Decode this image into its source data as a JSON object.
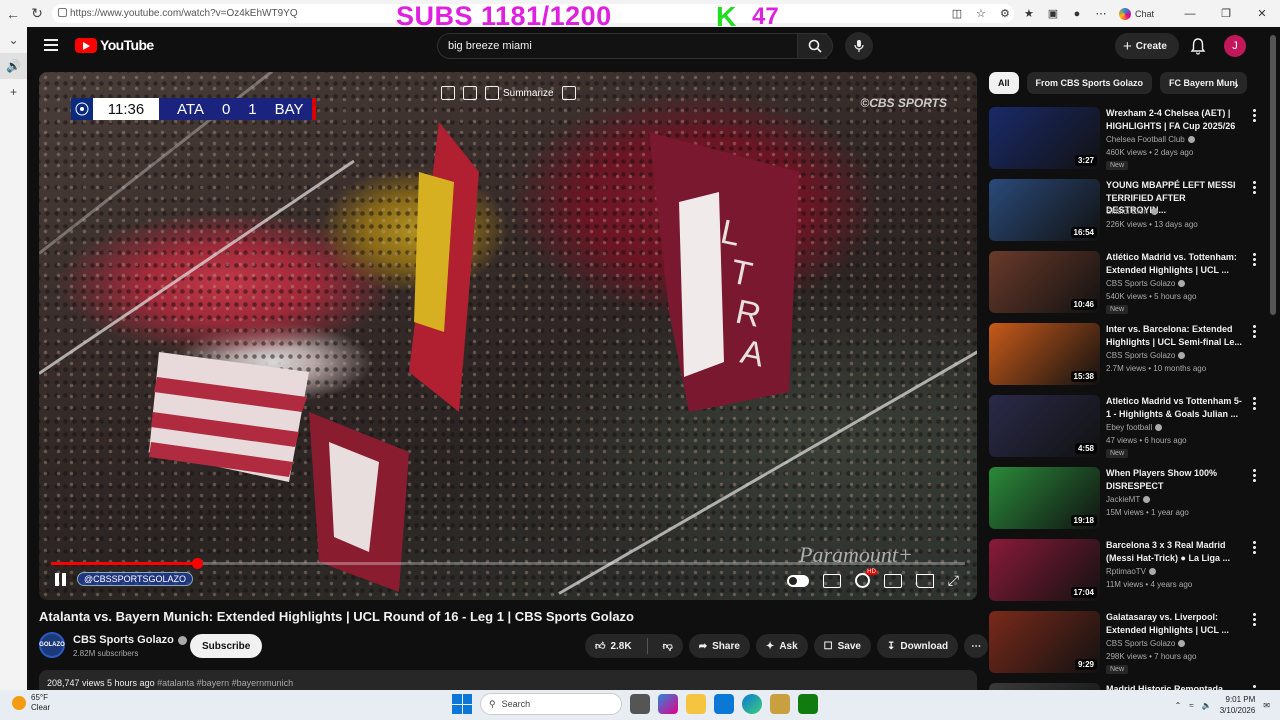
{
  "browser": {
    "url": "https://www.youtube.com/watch?v=Oz4kEhWT9YQ",
    "chat_label": "Chat"
  },
  "overlay": {
    "subs_text": "SUBS 1181/1200",
    "k_letter": "K",
    "k_count": "47"
  },
  "header": {
    "logo_text": "YouTube",
    "search_value": "big breeze miami",
    "create_label": "Create",
    "avatar_letter": "J"
  },
  "player": {
    "clock": "11:36",
    "home_team": "ATA",
    "home_score": "0",
    "away_score": "1",
    "away_team": "BAY",
    "broadcaster": "©CBS SPORTS",
    "summarize_label": "Summarize",
    "paramount_mark": "Paramount+",
    "channel_chip": "@CBSSPORTSGOLAZO",
    "progress_fraction": 0.16
  },
  "video": {
    "title": "Atalanta vs. Bayern Munich: Extended Highlights | UCL Round of 16 - Leg 1 | CBS Sports Golazo",
    "channel_name": "CBS Sports Golazo",
    "channel_avatar_text": "GOLAZO",
    "subscribers": "2.82M subscribers",
    "subscribe_label": "Subscribe",
    "likes": "2.8K",
    "share_label": "Share",
    "ask_label": "Ask",
    "save_label": "Save",
    "download_label": "Download",
    "views_time": "208,747 views  5 hours ago",
    "tags": "#atalanta #bayern #bayernmunich"
  },
  "chips": [
    "All",
    "From CBS Sports Golazo",
    "FC Bayern Muni"
  ],
  "recommendations": [
    {
      "title": "Wrexham 2-4 Chelsea (AET) | HIGHLIGHTS | FA Cup 2025/26",
      "channel": "Chelsea Football Club",
      "meta": "460K views • 2 days ago",
      "badge": "New",
      "duration": "3:27",
      "thumb_color": "#1a2a6a"
    },
    {
      "title": "YOUNG MBAPPÉ LEFT MESSI TERRIFIED AFTER DESTROYIN...",
      "channel": "Skibidi Elon",
      "meta": "226K views • 13 days ago",
      "badge": "",
      "duration": "16:54",
      "thumb_color": "#2a4a7a"
    },
    {
      "title": "Atlético Madrid vs. Tottenham: Extended Highlights | UCL ...",
      "channel": "CBS Sports Golazo",
      "meta": "540K views • 5 hours ago",
      "badge": "New",
      "duration": "10:46",
      "thumb_color": "#6a3a2a"
    },
    {
      "title": "Inter vs. Barcelona: Extended Highlights | UCL Semi-final Le...",
      "channel": "CBS Sports Golazo",
      "meta": "2.7M views • 10 months ago",
      "badge": "",
      "duration": "15:38",
      "thumb_color": "#c85a1a"
    },
    {
      "title": "Atletico Madrid vs Tottenham 5-1 - Highlights & Goals Julian ...",
      "channel": "Ebey football",
      "meta": "47 views • 6 hours ago",
      "badge": "New",
      "duration": "4:58",
      "thumb_color": "#2a2a4a"
    },
    {
      "title": "When Players Show 100% DISRESPECT",
      "channel": "JackieMT",
      "meta": "15M views • 1 year ago",
      "badge": "",
      "duration": "19:18",
      "thumb_color": "#2a8a3a"
    },
    {
      "title": "Barcelona 3 x 3 Real Madrid (Messi Hat-Trick) ● La Liga ...",
      "channel": "RptimaoTV",
      "meta": "11M views • 4 years ago",
      "badge": "",
      "duration": "17:04",
      "thumb_color": "#8a1a3a"
    },
    {
      "title": "Galatasaray vs. Liverpool: Extended Highlights | UCL ...",
      "channel": "CBS Sports Golazo",
      "meta": "298K views • 7 hours ago",
      "badge": "New",
      "duration": "9:29",
      "thumb_color": "#7a2a1a"
    },
    {
      "title": "Madrid Historic Remontada",
      "channel": "",
      "meta": "",
      "badge": "",
      "duration": "",
      "thumb_color": "#3a3a3a"
    }
  ],
  "taskbar": {
    "temperature": "65°F",
    "weather": "Clear",
    "search_label": "Search",
    "time": "9:01 PM",
    "date": "3/10/2026"
  }
}
